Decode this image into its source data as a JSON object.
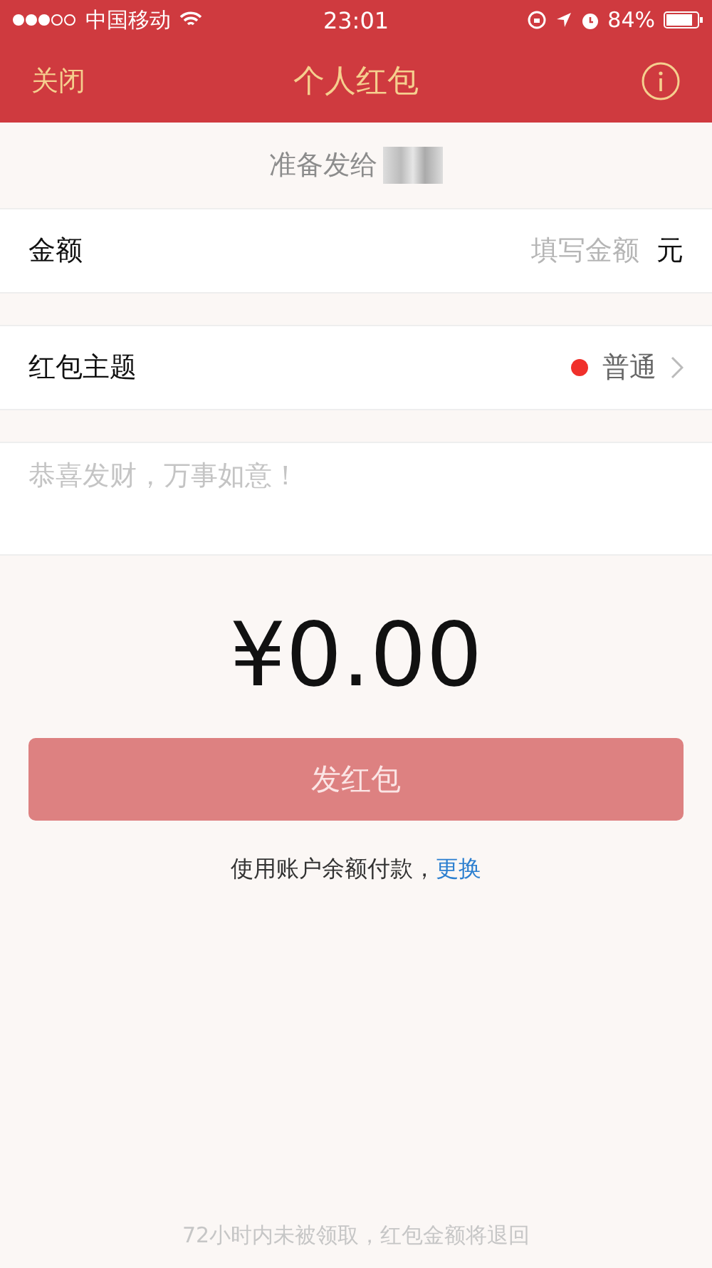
{
  "status_bar": {
    "carrier": "中国移动",
    "time": "23:01",
    "battery": "84%"
  },
  "nav": {
    "close": "关闭",
    "title": "个人红包"
  },
  "recipient": {
    "label": "准备发给"
  },
  "amount_row": {
    "label": "金额",
    "placeholder": "填写金额",
    "unit": "元"
  },
  "theme_row": {
    "label": "红包主题",
    "value": "普通"
  },
  "greeting": {
    "placeholder": "恭喜发财，万事如意！"
  },
  "total": "¥0.00",
  "send_button": {
    "label": "发红包",
    "disabled": true
  },
  "payment": {
    "text": "使用账户余额付款，",
    "link": "更换"
  },
  "footer": "72小时内未被领取，红包金额将退回"
}
